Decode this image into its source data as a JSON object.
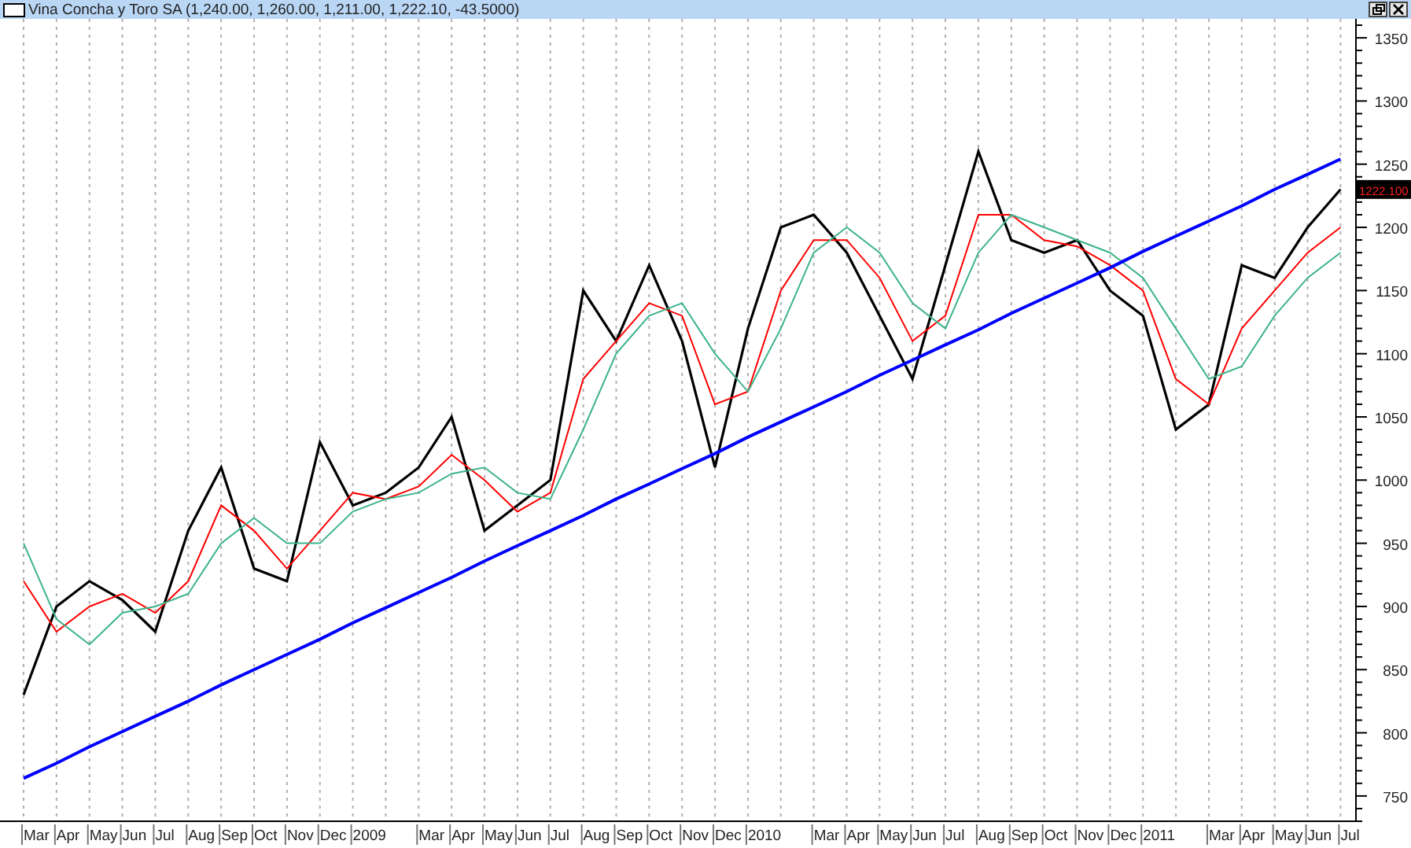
{
  "window": {
    "title": "Vina Concha y Toro SA (1,240.00, 1,260.00, 1,211.00, 1,222.10, -43.5000)"
  },
  "chart": {
    "price_label": "1222.100",
    "chart_data": {
      "type": "line",
      "categories": [
        "Mar",
        "Apr",
        "May",
        "Jun",
        "Jul",
        "Aug",
        "Sep",
        "Oct",
        "Nov",
        "Dec",
        "2009",
        null,
        "Mar",
        "Apr",
        "May",
        "Jun",
        "Jul",
        "Aug",
        "Sep",
        "Oct",
        "Nov",
        "Dec",
        "2010",
        null,
        "Mar",
        "Apr",
        "May",
        "Jun",
        "Jul",
        "Aug",
        "Sep",
        "Oct",
        "Nov",
        "Dec",
        "2011",
        null,
        "Mar",
        "Apr",
        "May",
        "Jun",
        "Jul"
      ],
      "series": [
        {
          "color": "#000000",
          "values": [
            830,
            900,
            920,
            905,
            880,
            960,
            1010,
            930,
            920,
            1030,
            980,
            990,
            1010,
            1050,
            960,
            980,
            1000,
            1150,
            1110,
            1170,
            1110,
            1010,
            1120,
            1200,
            1210,
            1180,
            1130,
            1080,
            1170,
            1260,
            1190,
            1180,
            1190,
            1150,
            1130,
            1040,
            1060,
            1170,
            1160,
            1200,
            1230
          ]
        },
        {
          "color": "#ff0000",
          "values": [
            920,
            880,
            900,
            910,
            895,
            920,
            980,
            960,
            930,
            960,
            990,
            985,
            995,
            1020,
            1000,
            975,
            990,
            1080,
            1110,
            1140,
            1130,
            1060,
            1070,
            1150,
            1190,
            1190,
            1160,
            1110,
            1130,
            1210,
            1210,
            1190,
            1185,
            1170,
            1150,
            1080,
            1060,
            1120,
            1150,
            1180,
            1200
          ]
        },
        {
          "color": "#3cb38a",
          "values": [
            950,
            890,
            870,
            895,
            900,
            910,
            950,
            970,
            950,
            950,
            975,
            985,
            990,
            1005,
            1010,
            990,
            985,
            1040,
            1100,
            1130,
            1140,
            1100,
            1070,
            1120,
            1180,
            1200,
            1180,
            1140,
            1120,
            1180,
            1210,
            1200,
            1190,
            1180,
            1160,
            1120,
            1080,
            1090,
            1130,
            1160,
            1180
          ]
        },
        {
          "color": "#0000ff",
          "values": [
            764,
            776,
            789,
            801,
            813,
            825,
            838,
            850,
            862,
            874,
            887,
            899,
            911,
            923,
            936,
            948,
            960,
            972,
            985,
            997,
            1009,
            1021,
            1034,
            1046,
            1058,
            1070,
            1083,
            1095,
            1107,
            1119,
            1132,
            1144,
            1156,
            1168,
            1181,
            1193,
            1205,
            1217,
            1230,
            1242,
            1254
          ]
        }
      ],
      "ylim": [
        730,
        1365
      ],
      "yticks": [
        750,
        800,
        850,
        900,
        950,
        1000,
        1050,
        1100,
        1150,
        1200,
        1250,
        1300,
        1350
      ]
    }
  }
}
